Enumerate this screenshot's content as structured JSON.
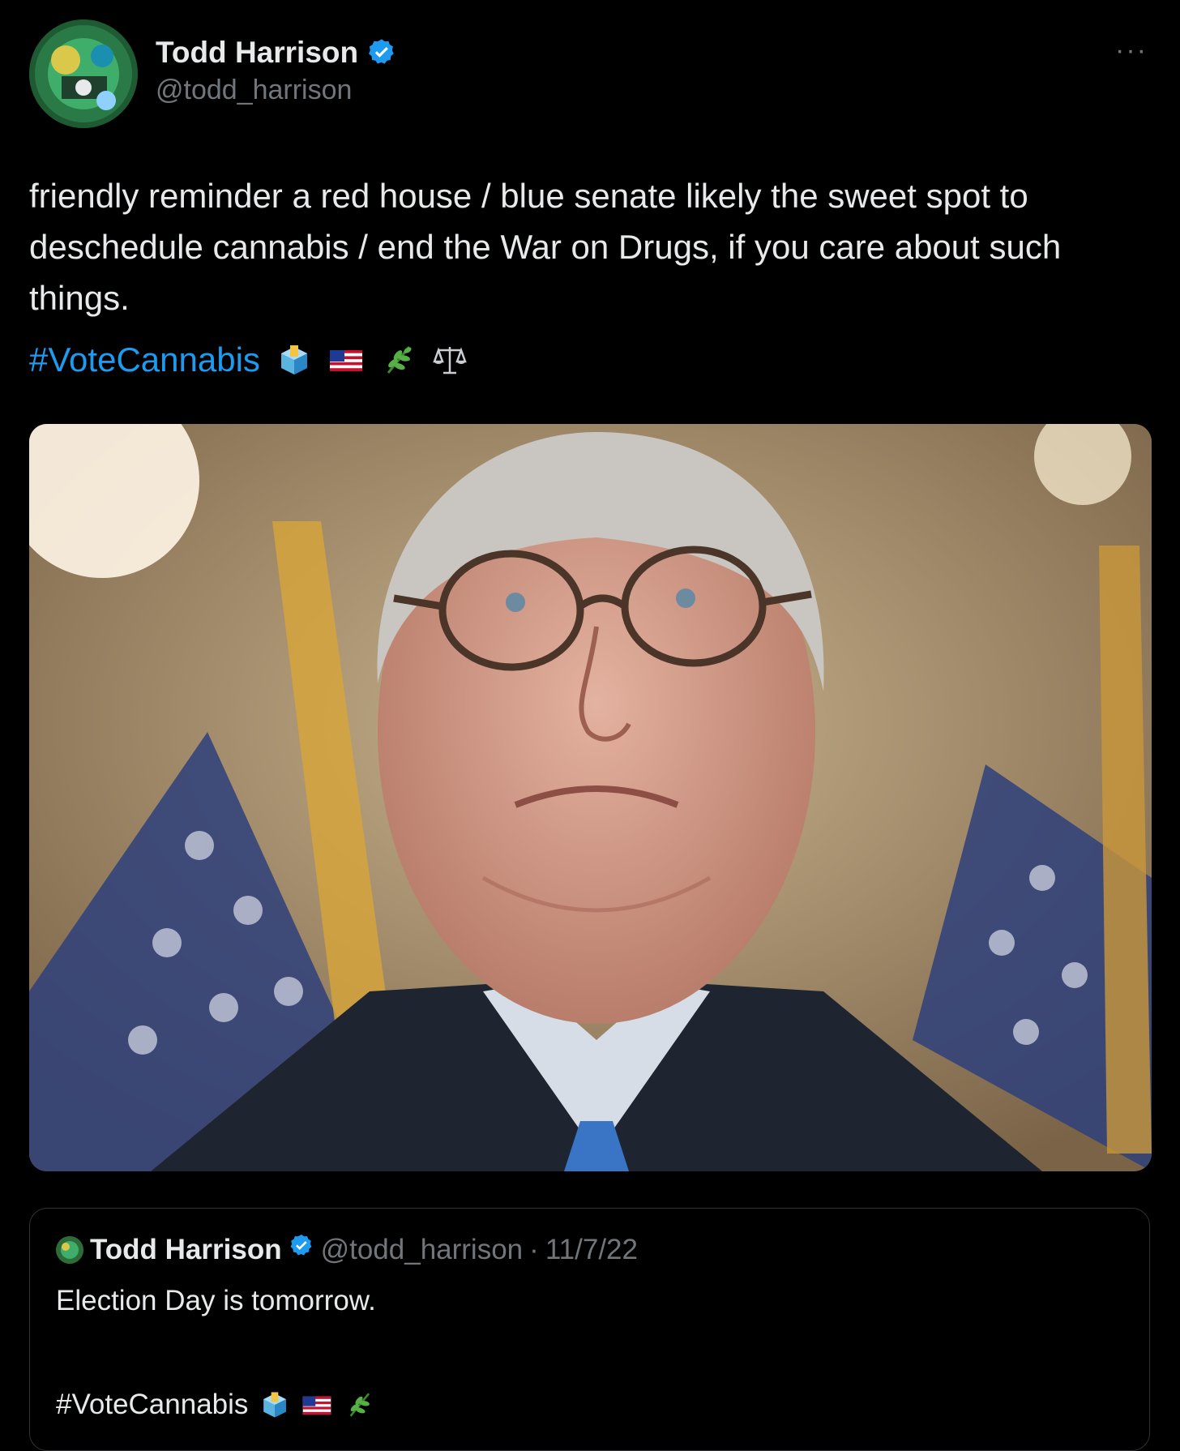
{
  "author": {
    "name": "Todd Harrison",
    "handle": "@todd_harrison",
    "verified": true
  },
  "more_label": "···",
  "tweet": {
    "text": "friendly reminder a red house / blue senate likely the sweet spot to deschedule cannabis / end the War on Drugs, if you care about such things.",
    "hashtag": "#VoteCannabis",
    "emojis": [
      "ballot-box-icon",
      "us-flag-icon",
      "herb-icon",
      "scales-icon"
    ]
  },
  "quoted_tweet": {
    "name": "Todd Harrison",
    "handle": "@todd_harrison",
    "separator": "·",
    "date": "11/7/22",
    "text": "Election Day is tomorrow.",
    "hashtag": "#VoteCannabis",
    "emojis": [
      "ballot-box-icon",
      "us-flag-icon",
      "herb-icon"
    ]
  },
  "colors": {
    "background": "#000000",
    "text": "#e7e9ea",
    "secondary": "#71767b",
    "link": "#1d9bf0",
    "verified": "#1d9bf0"
  }
}
